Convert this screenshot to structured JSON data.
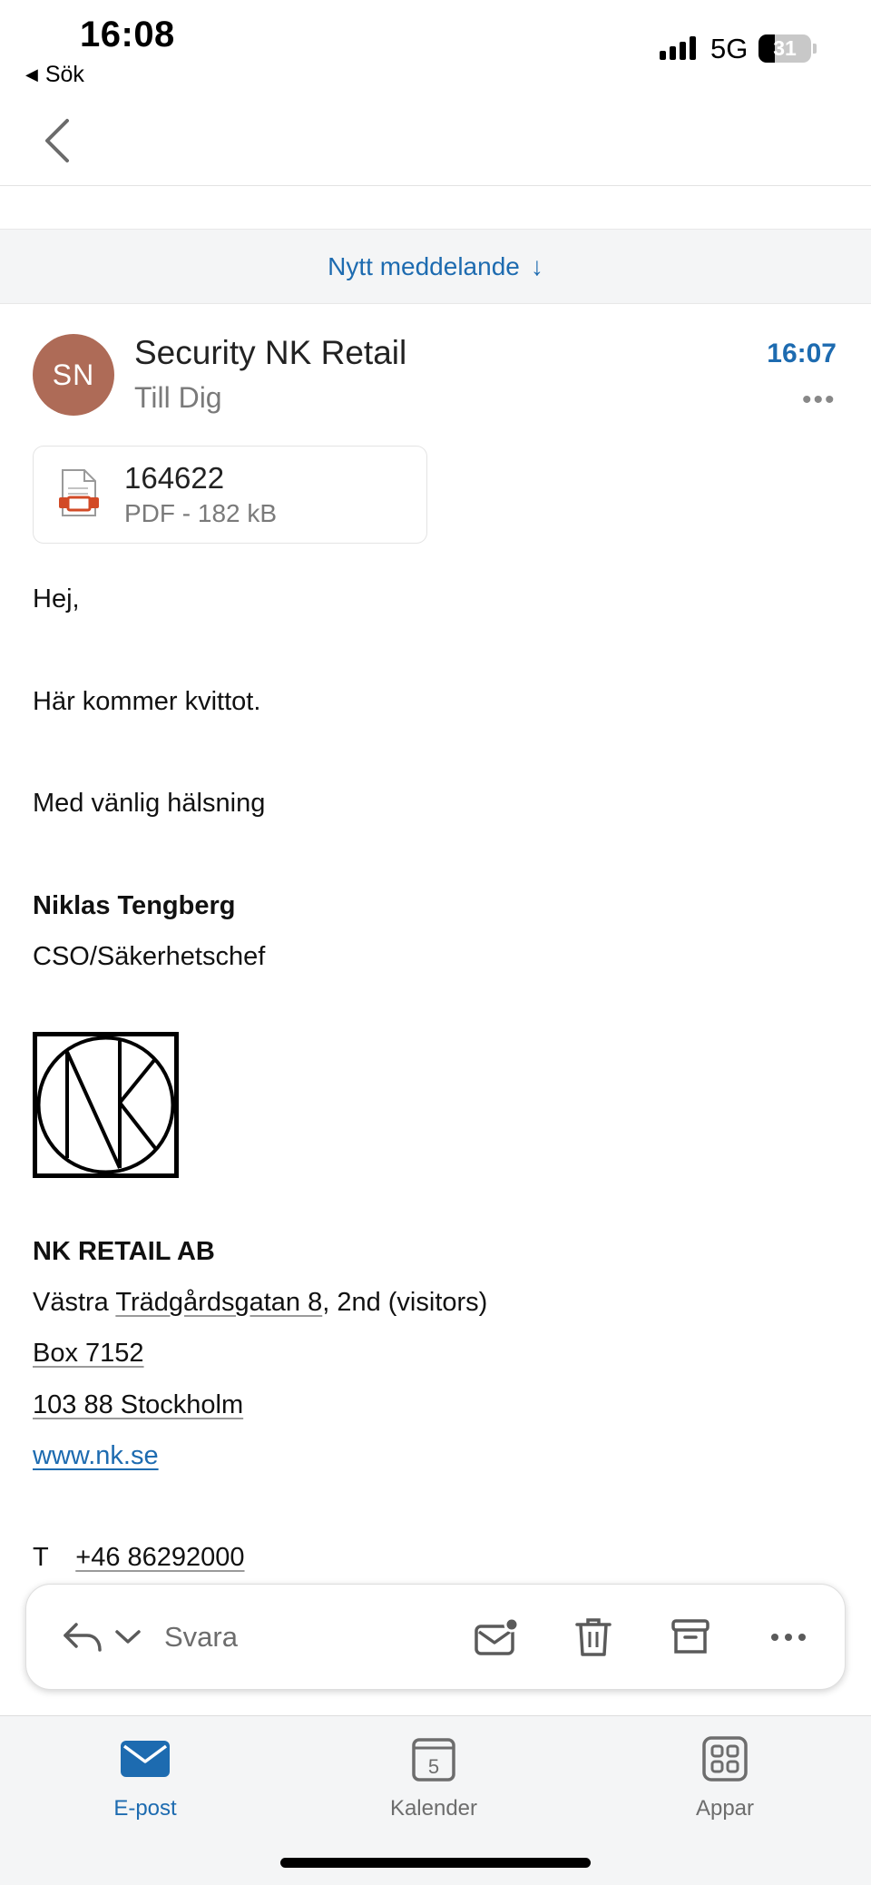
{
  "status": {
    "time": "16:08",
    "back_app": "Sök",
    "network": "5G",
    "battery": "31"
  },
  "toolbar": {
    "new_message": "Nytt meddelande"
  },
  "email": {
    "avatar_initials": "SN",
    "sender": "Security NK Retail",
    "recipient": "Till Dig",
    "time": "16:07",
    "attachment": {
      "name": "164622",
      "meta": "PDF - 182 kB"
    },
    "body": {
      "greeting": "Hej,",
      "line": "Här kommer kvittot.",
      "closing": "Med vänlig hälsning"
    },
    "signature": {
      "name": "Niklas Tengberg",
      "title": "CSO/Säkerhetschef",
      "company": "NK RETAIL AB",
      "address_prefix": "Västra ",
      "address_street": "Trädgårdsgatan 8",
      "address_suffix": ", 2nd (visitors)",
      "box": "Box 7152",
      "city": "103 88 Stockholm",
      "website": "www.nk.se",
      "phone_prefix": "T",
      "phone": "+46 86292000"
    }
  },
  "reply_bar": {
    "reply_label": "Svara"
  },
  "tabs": [
    {
      "label": "E-post",
      "active": true
    },
    {
      "label": "Kalender",
      "badge": "5"
    },
    {
      "label": "Appar"
    }
  ],
  "colors": {
    "accent": "#1d6bb0",
    "avatar": "#ae6b57"
  }
}
